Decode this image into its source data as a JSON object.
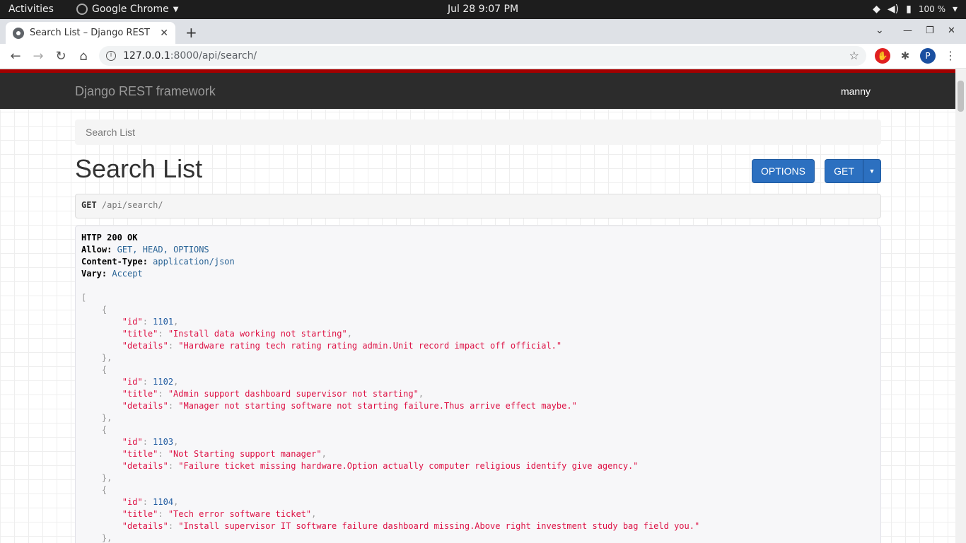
{
  "os": {
    "activities": "Activities",
    "app_name": "Google Chrome",
    "clock": "Jul 28   9:07 PM",
    "battery": "100 %"
  },
  "browser": {
    "tab_title": "Search List – Django REST",
    "url_host": "127.0.0.1",
    "url_path": ":8000/api/search/",
    "profile_initial": "P"
  },
  "drf": {
    "brand": "Django REST framework",
    "user": "manny",
    "breadcrumb": "Search List",
    "title": "Search List",
    "options_label": "OPTIONS",
    "get_label": "GET",
    "request_method": "GET",
    "request_path": "/api/search/"
  },
  "response": {
    "status": "HTTP 200 OK",
    "headers": [
      {
        "key": "Allow:",
        "value": "GET, HEAD, OPTIONS"
      },
      {
        "key": "Content-Type:",
        "value": "application/json"
      },
      {
        "key": "Vary:",
        "value": "Accept"
      }
    ],
    "items": [
      {
        "id": "1101",
        "title": "\"Install data working not starting\"",
        "details": "\"Hardware rating tech rating rating admin.Unit record impact off official.\""
      },
      {
        "id": "1102",
        "title": "\"Admin support dashboard supervisor not starting\"",
        "details": "\"Manager not starting software not starting failure.Thus arrive effect maybe.\""
      },
      {
        "id": "1103",
        "title": "\"Not Starting support manager\"",
        "details": "\"Failure ticket missing hardware.Option actually computer religious identify give agency.\""
      },
      {
        "id": "1104",
        "title": "\"Tech error software ticket\"",
        "details": "\"Install supervisor IT software failure dashboard missing.Above right investment study bag field you.\""
      }
    ]
  }
}
